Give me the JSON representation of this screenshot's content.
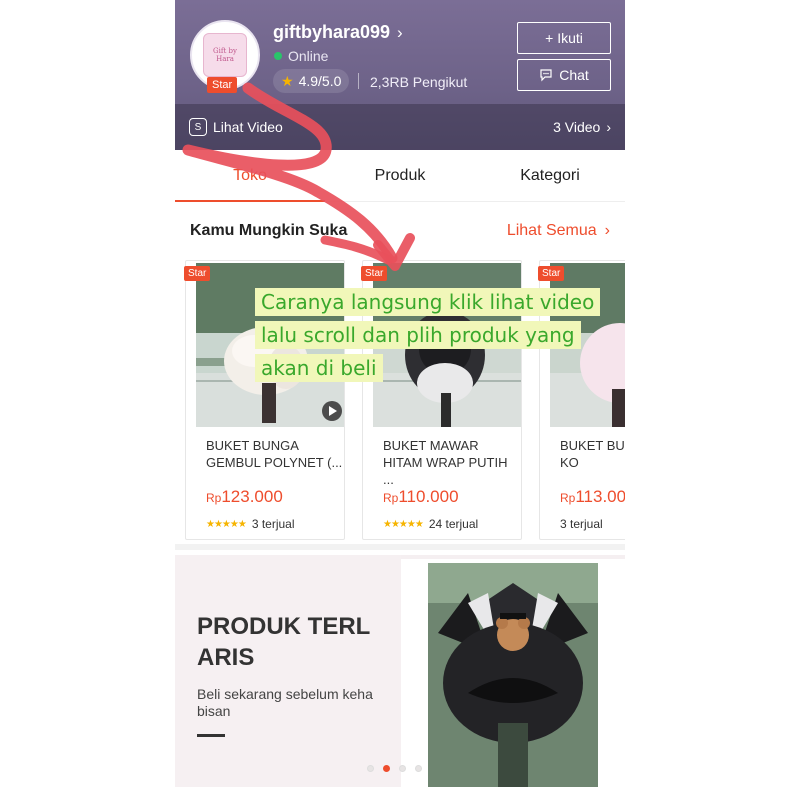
{
  "shop": {
    "avatar_text": "Gift by Hara",
    "badge": "Star",
    "name": "giftbyhara099",
    "name_chevron": "›",
    "status": "Online",
    "rating": "4.9/5.0",
    "followers": "2,3RB Pengikut",
    "follow_label": "+ Ikuti",
    "chat_label": "Chat",
    "video_label": "Lihat Video",
    "video_count": "3 Video",
    "video_icon": "S"
  },
  "tabs": [
    {
      "label": "Toko"
    },
    {
      "label": "Produk"
    },
    {
      "label": "Kategori"
    }
  ],
  "section": {
    "title": "Kamu Mungkin Suka",
    "see_all": "Lihat Semua"
  },
  "products": [
    {
      "badge": "Star",
      "title": "BUKET BUNGA GEMBUL  POLYNET (...",
      "currency": "Rp",
      "price": "123.000",
      "stars": "★★★★★",
      "sold": "3 terjual"
    },
    {
      "badge": "Star",
      "title": "BUKET MAWAR HITAM WRAP PUTIH ...",
      "currency": "Rp",
      "price": "110.000",
      "stars": "★★★★★",
      "sold": "24 terjual"
    },
    {
      "badge": "Star",
      "title": "BUKET BUN VINTAGE KO",
      "currency": "Rp",
      "price": "113.00",
      "stars": "",
      "sold": "3 terjual"
    }
  ],
  "banner": {
    "title": "PRODUK TERL ARIS",
    "subtitle": "Beli sekarang sebelum keha bisan",
    "dots_count": 4,
    "active_dot": 1
  },
  "annotation": {
    "text": "Caranya langsung klik lihat video lalu scroll dan plih produk yang akan di beli"
  },
  "colors": {
    "accent": "#ee4d2d",
    "header": "#6d6288",
    "annotation_text": "#3aa82c",
    "annotation_bg": "#f1f7b9",
    "arrow": "#e8505b"
  },
  "icons": {
    "chevron": "chevron-right-icon",
    "star": "star-icon",
    "chat": "chat-icon",
    "play": "play-icon",
    "video": "video-icon"
  }
}
